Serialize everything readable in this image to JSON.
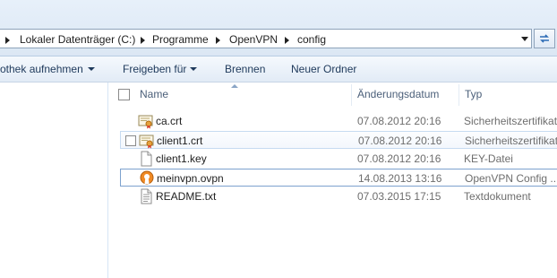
{
  "breadcrumb": [
    "Lokaler Datenträger (C:)",
    "Programme",
    "OpenVPN",
    "config"
  ],
  "toolbar": {
    "library": "othek aufnehmen",
    "share": "Freigeben für",
    "burn": "Brennen",
    "new_folder": "Neuer Ordner"
  },
  "columns": {
    "name": "Name",
    "date": "Änderungsdatum",
    "type": "Typ"
  },
  "files": [
    {
      "name": "ca.crt",
      "date": "07.08.2012 20:16",
      "type": "Sicherheitszertifikat",
      "icon": "certificate-icon"
    },
    {
      "name": "client1.crt",
      "date": "07.08.2012 20:16",
      "type": "Sicherheitszertifikat",
      "icon": "certificate-icon"
    },
    {
      "name": "client1.key",
      "date": "07.08.2012 20:16",
      "type": "KEY-Datei",
      "icon": "blank-file-icon"
    },
    {
      "name": "meinvpn.ovpn",
      "date": "14.08.2013 13:16",
      "type": "OpenVPN Config ...",
      "icon": "openvpn-config-icon"
    },
    {
      "name": "README.txt",
      "date": "07.03.2015 17:15",
      "type": "Textdokument",
      "icon": "text-file-icon"
    }
  ]
}
